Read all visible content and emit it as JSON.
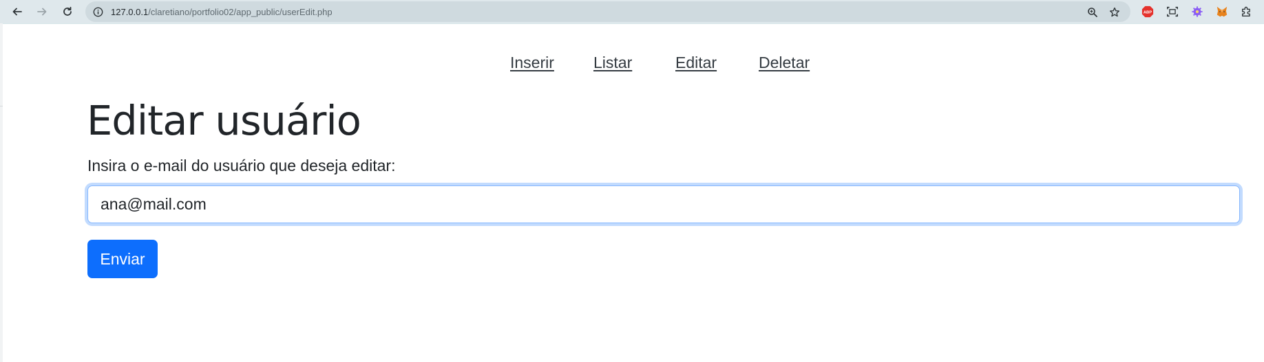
{
  "browser": {
    "url_host": "127.0.0.1",
    "url_path": "/claretiano/portfolio02/app_public/userEdit.php",
    "extensions": [
      "adblock-plus",
      "screenshot",
      "settings-gear",
      "metamask",
      "extensions-puzzle"
    ]
  },
  "nav": {
    "links": [
      {
        "label": "Inserir"
      },
      {
        "label": "Listar"
      },
      {
        "label": "Editar"
      },
      {
        "label": "Deletar"
      }
    ]
  },
  "page": {
    "title": "Editar usuário",
    "prompt": "Insira o e-mail do usuário que deseja editar:",
    "email_value": "ana@mail.com",
    "submit_label": "Enviar"
  },
  "colors": {
    "primary": "#0d6efd",
    "text": "#212529",
    "focus_border": "#86b7fe"
  }
}
